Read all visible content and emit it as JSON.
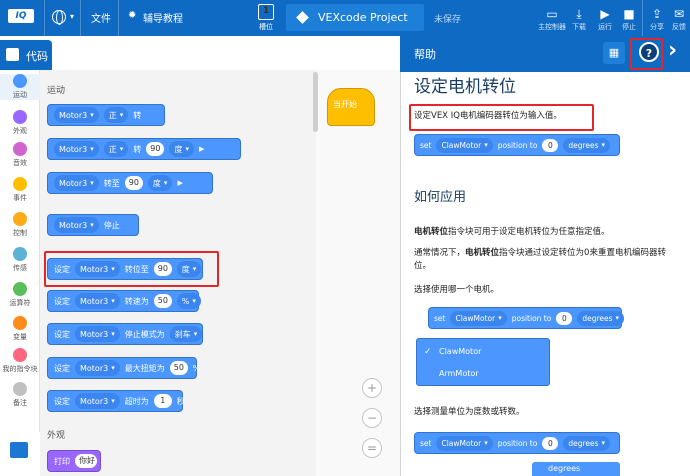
{
  "topbar": {
    "logo": "IQ",
    "file_label": "文件",
    "tutorials_label": "辅导教程",
    "slot_number": "1",
    "slot_label": "槽位",
    "project_name": "VEXcode Project",
    "save_status": "未保存",
    "tools": [
      {
        "icon": "brain-icon",
        "label": "主控制器"
      },
      {
        "icon": "download-icon",
        "label": "下载"
      },
      {
        "icon": "run-icon",
        "label": "运行"
      },
      {
        "icon": "stop-icon",
        "label": "停止"
      },
      {
        "icon": "share-icon",
        "label": "分享"
      },
      {
        "icon": "feedback-icon",
        "label": "反馈"
      }
    ]
  },
  "code_tab": {
    "label": "代码"
  },
  "categories": [
    {
      "label": "运动",
      "color": "#4c97ff"
    },
    {
      "label": "外观",
      "color": "#9966ff"
    },
    {
      "label": "音效",
      "color": "#cf63cf"
    },
    {
      "label": "事件",
      "color": "#ffbf00"
    },
    {
      "label": "控制",
      "color": "#ffab19"
    },
    {
      "label": "传感",
      "color": "#5cb1d6"
    },
    {
      "label": "运算符",
      "color": "#59c059"
    },
    {
      "label": "变量",
      "color": "#ff8c1a"
    },
    {
      "label": "我的指令块",
      "color": "#ff6680"
    },
    {
      "label": "备注",
      "color": "#c0c0c0"
    }
  ],
  "palette": {
    "motion_title": "运动",
    "looks_title": "外观",
    "blocks": {
      "spin": {
        "motor": "Motor3",
        "dir": "正",
        "text": "转"
      },
      "spin_for": {
        "motor": "Motor3",
        "dir": "正",
        "text": "转",
        "value": "90",
        "unit": "度"
      },
      "spin_to": {
        "motor": "Motor3",
        "text": "转至",
        "value": "90",
        "unit": "度"
      },
      "stop": {
        "motor": "Motor3",
        "text": "停止"
      },
      "set_position": {
        "set": "设定",
        "motor": "Motor3",
        "text": "转位至",
        "value": "90",
        "unit": "度"
      },
      "set_velocity": {
        "set": "设定",
        "motor": "Motor3",
        "text": "转速为",
        "value": "50",
        "unit": "%"
      },
      "set_stopping": {
        "set": "设定",
        "motor": "Motor3",
        "text": "停止模式为",
        "mode": "刹车"
      },
      "set_torque": {
        "set": "设定",
        "motor": "Motor3",
        "text": "最大扭矩为",
        "value": "50",
        "unit": "%"
      },
      "set_timeout": {
        "set": "设定",
        "motor": "Motor3",
        "text": "超时为",
        "value": "1",
        "unit": "秒"
      },
      "print": {
        "text": "打印",
        "value": "你好"
      }
    }
  },
  "workspace": {
    "start_block": "当开始",
    "zoom_in": "+",
    "zoom_out": "−",
    "zoom_reset": "="
  },
  "help": {
    "header_title": "帮助",
    "help_button": "?",
    "title": "设定电机转位",
    "description": "设定VEX IQ电机编码器转位为输入值。",
    "example_block": {
      "set": "set",
      "motor": "ClawMotor",
      "mid": "position to",
      "value": "0",
      "unit": "degrees"
    },
    "how_to_title": "如何应用",
    "para1_bold": "电机转位",
    "para1_rest": "指令块可用于设定电机转位为任意指定值。",
    "para2_pre": "通常情况下，",
    "para2_bold": "电机转位",
    "para2_rest": "指令块通过设定转位为0来重置电机编码器转位。",
    "para3": "选择使用哪一个电机。",
    "motor_block": {
      "set": "set",
      "motor": "ClawMotor",
      "mid": "position to",
      "value": "0",
      "unit": "degrees"
    },
    "motor_menu": [
      "ClawMotor",
      "ArmMotor"
    ],
    "para4": "选择测量单位为度数或转数。",
    "unit_block": {
      "set": "set",
      "motor": "ClawMotor",
      "mid": "position to",
      "value": "0",
      "unit": "degrees"
    },
    "unit_menu_first": "degrees"
  }
}
